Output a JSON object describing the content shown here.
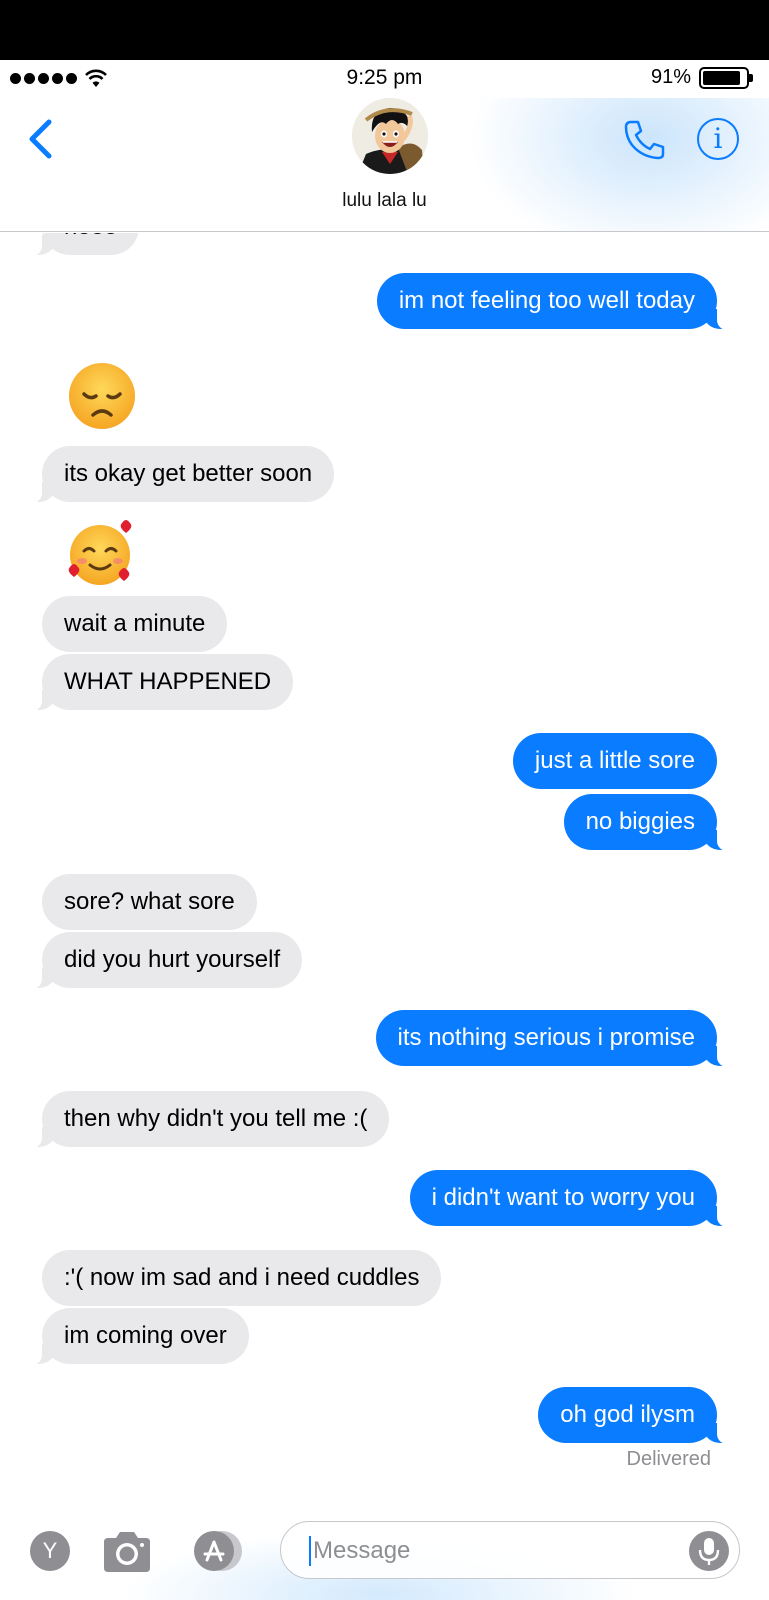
{
  "status_bar": {
    "time": "9:25 pm",
    "battery_percent": "91%",
    "battery_level": 0.91,
    "signal_bars": 5
  },
  "header": {
    "contact_name": "lulu lala lu",
    "back_icon": "chevron-left-icon",
    "call_icon": "phone-icon",
    "info_label": "i",
    "accent_color": "#0a7cff"
  },
  "messages": [
    {
      "side": "received",
      "text": "heee"
    },
    {
      "side": "sent",
      "text": "im not feeling too well today"
    },
    {
      "side": "received",
      "type": "emoji",
      "emoji": "disappointed-face"
    },
    {
      "side": "received",
      "text": "its okay get better soon"
    },
    {
      "side": "received",
      "type": "emoji",
      "emoji": "smiling-face-with-hearts"
    },
    {
      "side": "received",
      "text": "wait a minute"
    },
    {
      "side": "received",
      "text": "WHAT HAPPENED"
    },
    {
      "side": "sent",
      "text": "just a little sore"
    },
    {
      "side": "sent",
      "text": "no biggies"
    },
    {
      "side": "received",
      "text": "sore? what sore"
    },
    {
      "side": "received",
      "text": "did you hurt yourself"
    },
    {
      "side": "sent",
      "text": "its nothing serious i promise"
    },
    {
      "side": "received",
      "text": "then why didn't you tell me :("
    },
    {
      "side": "sent",
      "text": "i didn't want to worry you"
    },
    {
      "side": "received",
      "text": ":'( now im sad and i need cuddles"
    },
    {
      "side": "received",
      "text": "im coming over"
    },
    {
      "side": "sent",
      "text": "oh god ilysm"
    }
  ],
  "delivered_label": "Delivered",
  "input_bar": {
    "y_label": "Y",
    "placeholder": "Message",
    "camera_icon": "camera-icon",
    "apps_icon": "app-store-icon",
    "mic_icon": "microphone-icon"
  },
  "colors": {
    "sent_bubble": "#0a7cff",
    "received_bubble": "#e9e9eb",
    "meta_text": "#8e8e93"
  }
}
